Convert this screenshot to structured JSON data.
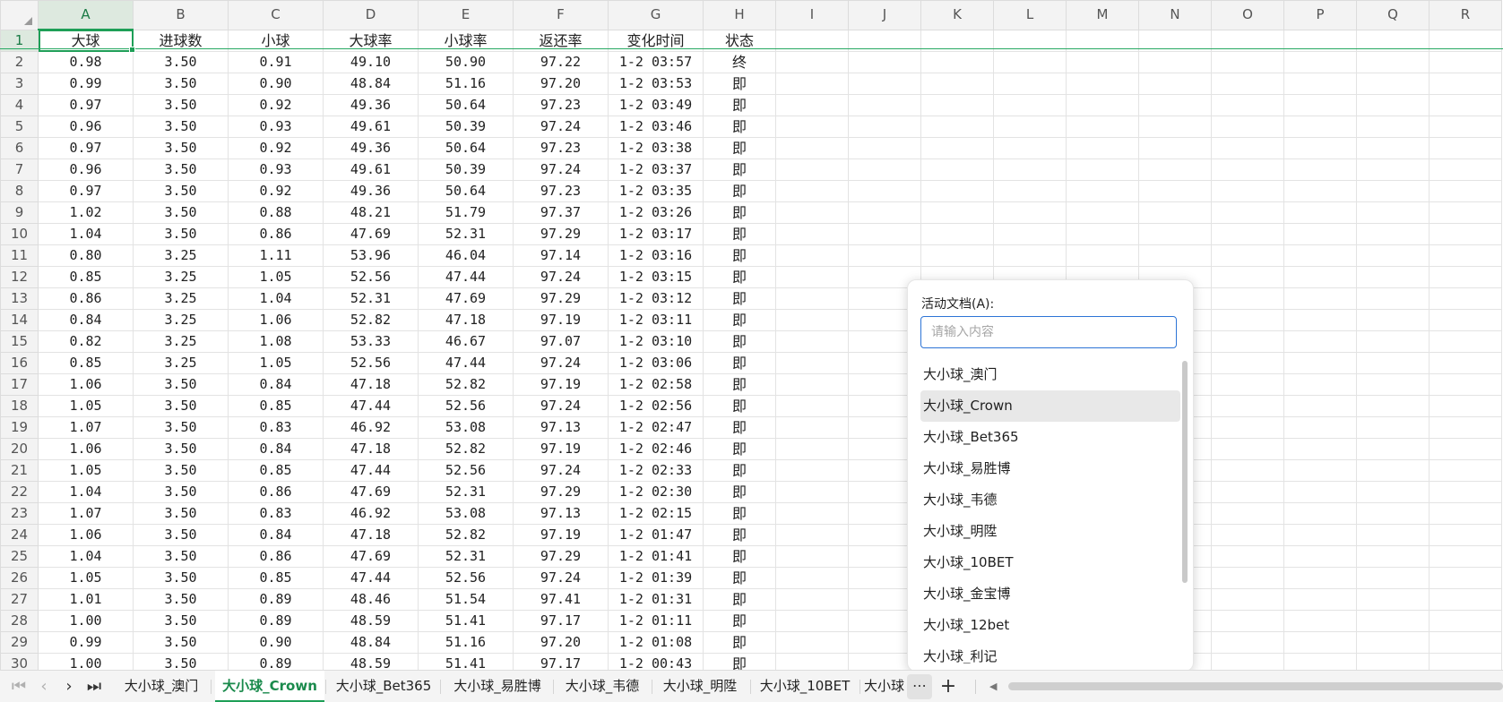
{
  "columns": [
    "A",
    "B",
    "C",
    "D",
    "E",
    "F",
    "G",
    "H",
    "I",
    "J",
    "K",
    "L",
    "M",
    "N",
    "O",
    "P",
    "Q",
    "R"
  ],
  "header_row": {
    "num": "1",
    "cells": [
      "大球",
      "进球数",
      "小球",
      "大球率",
      "小球率",
      "返还率",
      "变化时间",
      "状态"
    ]
  },
  "rows": [
    {
      "num": "2",
      "cells": [
        "0.98",
        "3.50",
        "0.91",
        "49.10",
        "50.90",
        "97.22",
        "1-2 03:57",
        "终"
      ]
    },
    {
      "num": "3",
      "cells": [
        "0.99",
        "3.50",
        "0.90",
        "48.84",
        "51.16",
        "97.20",
        "1-2 03:53",
        "即"
      ]
    },
    {
      "num": "4",
      "cells": [
        "0.97",
        "3.50",
        "0.92",
        "49.36",
        "50.64",
        "97.23",
        "1-2 03:49",
        "即"
      ]
    },
    {
      "num": "5",
      "cells": [
        "0.96",
        "3.50",
        "0.93",
        "49.61",
        "50.39",
        "97.24",
        "1-2 03:46",
        "即"
      ]
    },
    {
      "num": "6",
      "cells": [
        "0.97",
        "3.50",
        "0.92",
        "49.36",
        "50.64",
        "97.23",
        "1-2 03:38",
        "即"
      ]
    },
    {
      "num": "7",
      "cells": [
        "0.96",
        "3.50",
        "0.93",
        "49.61",
        "50.39",
        "97.24",
        "1-2 03:37",
        "即"
      ]
    },
    {
      "num": "8",
      "cells": [
        "0.97",
        "3.50",
        "0.92",
        "49.36",
        "50.64",
        "97.23",
        "1-2 03:35",
        "即"
      ]
    },
    {
      "num": "9",
      "cells": [
        "1.02",
        "3.50",
        "0.88",
        "48.21",
        "51.79",
        "97.37",
        "1-2 03:26",
        "即"
      ]
    },
    {
      "num": "10",
      "cells": [
        "1.04",
        "3.50",
        "0.86",
        "47.69",
        "52.31",
        "97.29",
        "1-2 03:17",
        "即"
      ]
    },
    {
      "num": "11",
      "cells": [
        "0.80",
        "3.25",
        "1.11",
        "53.96",
        "46.04",
        "97.14",
        "1-2 03:16",
        "即"
      ]
    },
    {
      "num": "12",
      "cells": [
        "0.85",
        "3.25",
        "1.05",
        "52.56",
        "47.44",
        "97.24",
        "1-2 03:15",
        "即"
      ]
    },
    {
      "num": "13",
      "cells": [
        "0.86",
        "3.25",
        "1.04",
        "52.31",
        "47.69",
        "97.29",
        "1-2 03:12",
        "即"
      ]
    },
    {
      "num": "14",
      "cells": [
        "0.84",
        "3.25",
        "1.06",
        "52.82",
        "47.18",
        "97.19",
        "1-2 03:11",
        "即"
      ]
    },
    {
      "num": "15",
      "cells": [
        "0.82",
        "3.25",
        "1.08",
        "53.33",
        "46.67",
        "97.07",
        "1-2 03:10",
        "即"
      ]
    },
    {
      "num": "16",
      "cells": [
        "0.85",
        "3.25",
        "1.05",
        "52.56",
        "47.44",
        "97.24",
        "1-2 03:06",
        "即"
      ]
    },
    {
      "num": "17",
      "cells": [
        "1.06",
        "3.50",
        "0.84",
        "47.18",
        "52.82",
        "97.19",
        "1-2 02:58",
        "即"
      ]
    },
    {
      "num": "18",
      "cells": [
        "1.05",
        "3.50",
        "0.85",
        "47.44",
        "52.56",
        "97.24",
        "1-2 02:56",
        "即"
      ]
    },
    {
      "num": "19",
      "cells": [
        "1.07",
        "3.50",
        "0.83",
        "46.92",
        "53.08",
        "97.13",
        "1-2 02:47",
        "即"
      ]
    },
    {
      "num": "20",
      "cells": [
        "1.06",
        "3.50",
        "0.84",
        "47.18",
        "52.82",
        "97.19",
        "1-2 02:46",
        "即"
      ]
    },
    {
      "num": "21",
      "cells": [
        "1.05",
        "3.50",
        "0.85",
        "47.44",
        "52.56",
        "97.24",
        "1-2 02:33",
        "即"
      ]
    },
    {
      "num": "22",
      "cells": [
        "1.04",
        "3.50",
        "0.86",
        "47.69",
        "52.31",
        "97.29",
        "1-2 02:30",
        "即"
      ]
    },
    {
      "num": "23",
      "cells": [
        "1.07",
        "3.50",
        "0.83",
        "46.92",
        "53.08",
        "97.13",
        "1-2 02:15",
        "即"
      ]
    },
    {
      "num": "24",
      "cells": [
        "1.06",
        "3.50",
        "0.84",
        "47.18",
        "52.82",
        "97.19",
        "1-2 01:47",
        "即"
      ]
    },
    {
      "num": "25",
      "cells": [
        "1.04",
        "3.50",
        "0.86",
        "47.69",
        "52.31",
        "97.29",
        "1-2 01:41",
        "即"
      ]
    },
    {
      "num": "26",
      "cells": [
        "1.05",
        "3.50",
        "0.85",
        "47.44",
        "52.56",
        "97.24",
        "1-2 01:39",
        "即"
      ]
    },
    {
      "num": "27",
      "cells": [
        "1.01",
        "3.50",
        "0.89",
        "48.46",
        "51.54",
        "97.41",
        "1-2 01:31",
        "即"
      ]
    },
    {
      "num": "28",
      "cells": [
        "1.00",
        "3.50",
        "0.89",
        "48.59",
        "51.41",
        "97.17",
        "1-2 01:11",
        "即"
      ]
    },
    {
      "num": "29",
      "cells": [
        "0.99",
        "3.50",
        "0.90",
        "48.84",
        "51.16",
        "97.20",
        "1-2 01:08",
        "即"
      ]
    },
    {
      "num": "30",
      "cells": [
        "1.00",
        "3.50",
        "0.89",
        "48.59",
        "51.41",
        "97.17",
        "1-2 00:43",
        "即"
      ]
    }
  ],
  "popup": {
    "label": "活动文档(A):",
    "placeholder": "请输入内容",
    "items": [
      "大小球_澳门",
      "大小球_Crown",
      "大小球_Bet365",
      "大小球_易胜博",
      "大小球_韦德",
      "大小球_明陞",
      "大小球_10BET",
      "大小球_金宝博",
      "大小球_12bet",
      "大小球_利记"
    ],
    "highlighted_item": "大小球_Crown"
  },
  "tabs": [
    "大小球_澳门",
    "大小球_Crown",
    "大小球_Bet365",
    "大小球_易胜博",
    "大小球_韦德",
    "大小球_明陞",
    "大小球_10BET",
    "大小球"
  ],
  "active_tab": "大小球_Crown",
  "tab_nav": {
    "first": "|<",
    "prev": "<",
    "next": ">",
    "last": ">|",
    "more": "⋯",
    "add": "+"
  },
  "colors": {
    "accent": "#1e9f57",
    "input_border": "#2d74d6"
  }
}
